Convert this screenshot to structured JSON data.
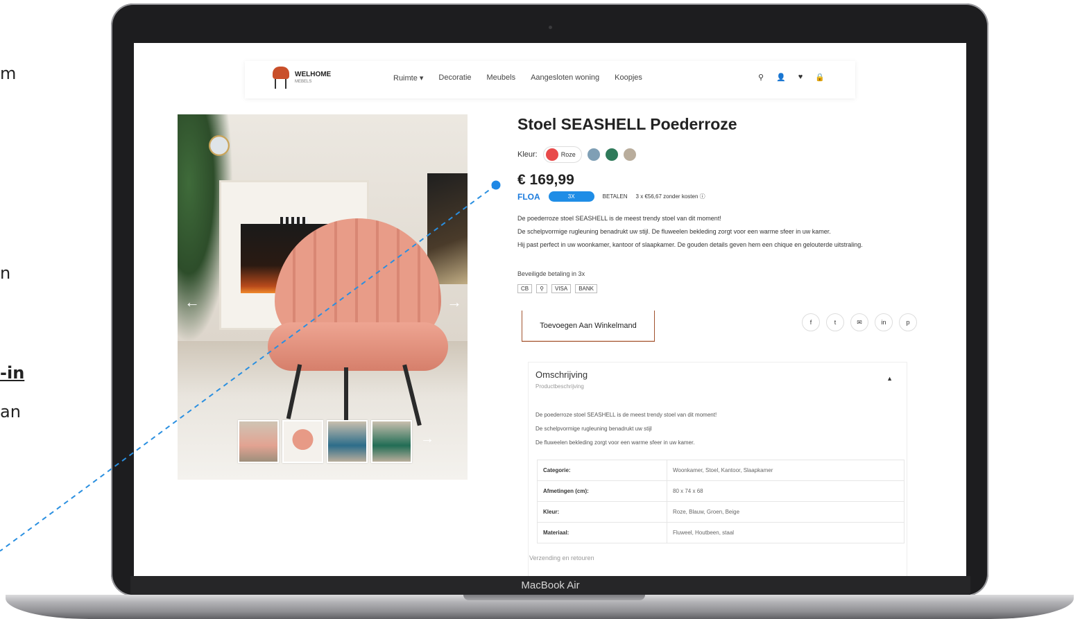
{
  "side_fragments": [
    "m",
    "n",
    "-in",
    "an"
  ],
  "device": {
    "label": "MacBook Air"
  },
  "header": {
    "logo_main": "WELHOME",
    "logo_sub": "MEBELS",
    "nav": [
      "Ruimte ▾",
      "Decoratie",
      "Meubels",
      "Aangesloten woning",
      "Koopjes"
    ],
    "icons": [
      "search-icon",
      "user-icon",
      "heart-icon",
      "cart-icon"
    ],
    "icon_glyphs": [
      "⚲",
      "👤",
      "♥",
      "🔒"
    ]
  },
  "product": {
    "title": "Stoel SEASHELL Poederroze",
    "color_label": "Kleur:",
    "selected_color_name": "Roze",
    "swatches": [
      "#e84a4a",
      "#7f9fb5",
      "#2f7a5a",
      "#b9ad9c"
    ],
    "price": "€ 169,99",
    "floa": {
      "logo": "FLOA",
      "pill": "3X",
      "label": "BETALEN",
      "installment": "3 x €56,67 zonder kosten ⓘ"
    },
    "description": [
      "De poederroze stoel SEASHELL is de meest trendy stoel van dit moment!",
      "De schelpvormige rugleuning benadrukt uw stijl. De fluweelen bekleding zorgt voor een warme sfeer in uw kamer.",
      "Hij past perfect in uw woonkamer, kantoor of slaapkamer. De gouden details geven hem een chique en gelouterde uitstraling."
    ],
    "payment_label": "Beveiligde betaling in 3x",
    "payment_icons": [
      "CB",
      "⚲",
      "VISA",
      "BANK"
    ],
    "add_to_cart": "Toevoegen Aan Winkelmand",
    "social": [
      "f",
      "t",
      "✉",
      "in",
      "p"
    ]
  },
  "description_panel": {
    "heading": "Omschrijving",
    "sub": "Productbeschrijving",
    "lines": [
      "De poederroze stoel SEASHELL is de meest trendy stoel van dit moment!",
      "De schelpvormige rugleuning benadrukt uw stijl",
      "De fluweelen bekleding zorgt voor een warme sfeer in uw kamer."
    ],
    "specs": [
      {
        "key": "Categorie:",
        "value": "Woonkamer, Stoel, Kantoor, Slaapkamer"
      },
      {
        "key": "Afmetingen (cm):",
        "value": "80 x 74 x 68"
      },
      {
        "key": "Kleur:",
        "value": "Roze, Blauw, Groen, Beige"
      },
      {
        "key": "Materiaal:",
        "value": "Fluweel, Houtbeen, staal"
      }
    ],
    "cut_text": "Verzending en retouren"
  }
}
